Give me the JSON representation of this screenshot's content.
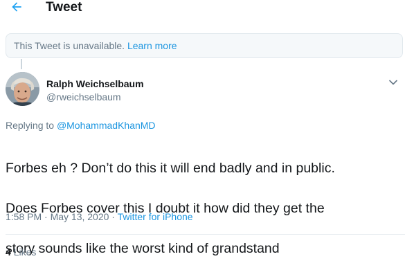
{
  "header": {
    "title": "Tweet",
    "back_icon": "arrow-left-icon"
  },
  "notice": {
    "text": "This Tweet is unavailable.",
    "link": "Learn more"
  },
  "tweet": {
    "author_name": "Ralph Weichselbaum",
    "author_handle": "@rweichselbaum",
    "replying_prefix": "Replying to",
    "replying_to": "@MohammadKhanMD",
    "text_lines": [
      "Forbes eh ? Don’t do this it will end badly and in public.",
      "Does Forbes cover this I doubt it how did they get the",
      "story sounds like the worst kind of grandstand"
    ],
    "timestamp": "1:58 PM · May 13, 2020 ·",
    "source": "Twitter for iPhone",
    "likes_count": "4",
    "likes_label": "Likes"
  },
  "colors": {
    "accent": "#1b95e0",
    "secondary_text": "#657786",
    "primary_text": "#14171a",
    "notice_bg": "#f5f8fa",
    "border": "#e1e8ed"
  }
}
